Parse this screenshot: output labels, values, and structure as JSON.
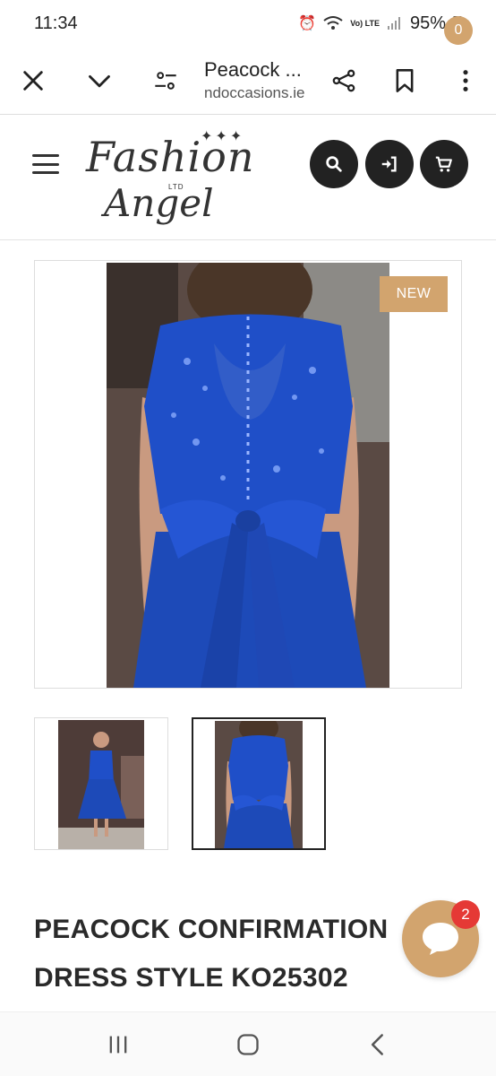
{
  "status_bar": {
    "time": "11:34",
    "volte": "Vo) LTE",
    "battery": "95%"
  },
  "browser": {
    "page_title": "Peacock ...",
    "domain": "ndoccasions.ie"
  },
  "site": {
    "logo_line1": "Fashion",
    "logo_ltd": "LTD",
    "logo_line2": "Angel",
    "cart_count": "0",
    "accent_color": "#d2a46e"
  },
  "product": {
    "badge": "NEW",
    "title": "PEACOCK CONFIRMATION DRESS STYLE KO25302",
    "image_color": "#1f4fc8"
  },
  "chat": {
    "unread_count": "2"
  },
  "icons": {
    "toolbar": [
      "close-icon",
      "chevron-down-icon",
      "site-settings-icon",
      "share-icon",
      "bookmark-icon",
      "more-icon"
    ],
    "header": [
      "menu-icon",
      "search-icon",
      "login-icon",
      "cart-icon"
    ],
    "nav": [
      "recent-apps-icon",
      "home-icon",
      "back-icon"
    ]
  }
}
